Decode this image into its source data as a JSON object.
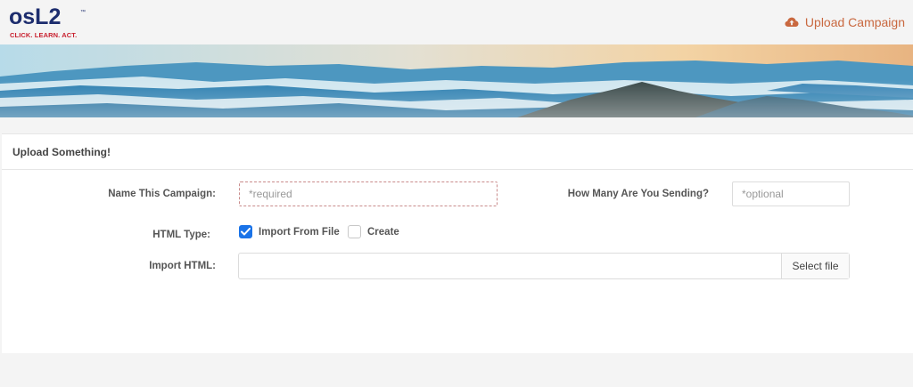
{
  "header": {
    "logo_word": "osL2",
    "logo_tm": "™",
    "logo_tagline": "CLICK. LEARN. ACT.",
    "upload_link_label": "Upload Campaign",
    "upload_icon": "cloud-upload-icon"
  },
  "colors": {
    "brand_navy": "#1d2d6e",
    "brand_red": "#c8202f",
    "accent_orange": "#c9683f",
    "checkbox_blue": "#1a73e8"
  },
  "card": {
    "title": "Upload Something!"
  },
  "form": {
    "campaign_name": {
      "label": "Name This Campaign:",
      "value": "",
      "placeholder": "*required"
    },
    "how_many": {
      "label": "How Many Are You Sending?",
      "value": "",
      "placeholder": "*optional"
    },
    "html_type": {
      "label": "HTML Type:",
      "options": [
        {
          "label": "Import From File",
          "checked": true
        },
        {
          "label": "Create",
          "checked": false
        }
      ]
    },
    "import_html": {
      "label": "Import HTML:",
      "file_name": "",
      "button_label": "Select file"
    }
  }
}
